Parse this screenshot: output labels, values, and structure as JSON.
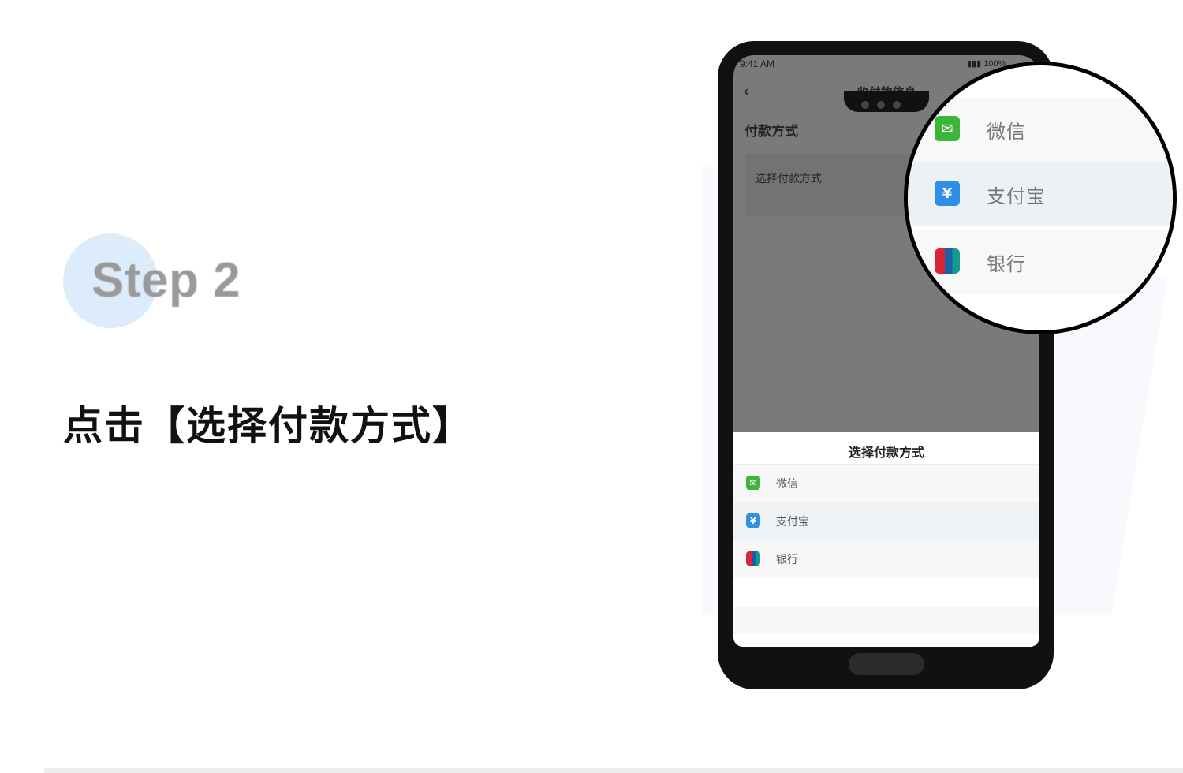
{
  "step": {
    "label": "Step 2"
  },
  "instruction": "点击【选择付款方式】",
  "phone": {
    "status_time": "9:41 AM",
    "status_right": "100%",
    "nav_title": "收付款信息",
    "back_icon": "chevron-left-icon",
    "section_label": "付款方式",
    "select_placeholder": "选择付款方式",
    "sheet": {
      "title": "选择付款方式",
      "options": [
        {
          "label": "微信",
          "icon": "wechat-icon",
          "color": "#3bb53a"
        },
        {
          "label": "支付宝",
          "icon": "alipay-icon",
          "color": "#2f8ee6"
        },
        {
          "label": "银行",
          "icon": "unionpay-icon",
          "color": "#d82634"
        }
      ]
    }
  },
  "magnifier": {
    "options": [
      {
        "label": "微信"
      },
      {
        "label": "支付宝"
      },
      {
        "label": "银行"
      }
    ]
  }
}
